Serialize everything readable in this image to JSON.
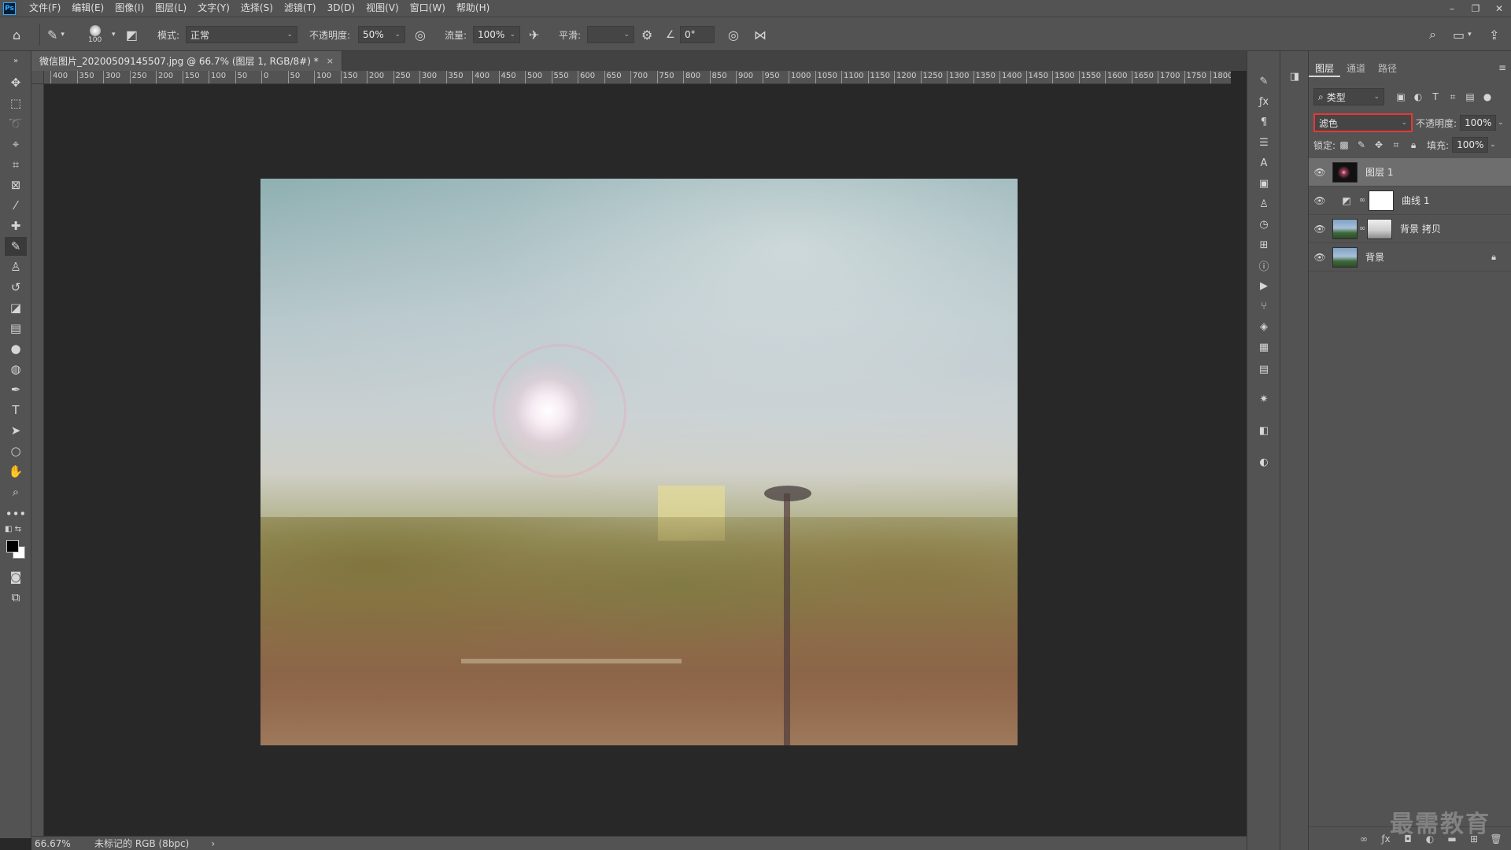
{
  "app": {
    "logo": "Ps"
  },
  "menu": [
    "文件(F)",
    "编辑(E)",
    "图像(I)",
    "图层(L)",
    "文字(Y)",
    "选择(S)",
    "滤镜(T)",
    "3D(D)",
    "视图(V)",
    "窗口(W)",
    "帮助(H)"
  ],
  "window_controls": {
    "minimize": "–",
    "restore": "❐",
    "close": "✕"
  },
  "options": {
    "brush_size": "100",
    "mode_label": "模式:",
    "mode_value": "正常",
    "opacity_label": "不透明度:",
    "opacity_value": "50%",
    "flow_label": "流量:",
    "flow_value": "100%",
    "smoothing_label": "平滑:",
    "smoothing_value": "",
    "angle_value": "0°"
  },
  "document": {
    "tab_title": "微信图片_20200509145507.jpg @ 66.7% (图层 1, RGB/8#) *",
    "tab_close": "×"
  },
  "ruler_h_labels": [
    "400",
    "350",
    "300",
    "250",
    "200",
    "150",
    "100",
    "50",
    "0",
    "50",
    "100",
    "150",
    "200",
    "250",
    "300",
    "350",
    "400",
    "450",
    "500",
    "550",
    "600",
    "650",
    "700",
    "750",
    "800",
    "850",
    "900",
    "950",
    "1000",
    "1050",
    "1100",
    "1150",
    "1200",
    "1250",
    "1300",
    "1350",
    "1400",
    "1450",
    "1500",
    "1550",
    "1600",
    "1650",
    "1700",
    "1750",
    "1800"
  ],
  "layers_panel": {
    "tabs": [
      "图层",
      "通道",
      "路径"
    ],
    "active_tab": "图层",
    "filter_kind": "类型",
    "blend_mode": "滤色",
    "opacity_label": "不透明度:",
    "opacity_value": "100%",
    "lock_label": "锁定:",
    "fill_label": "填充:",
    "fill_value": "100%",
    "layers": [
      {
        "name": "图层 1",
        "selected": true,
        "locked": false
      },
      {
        "name": "曲线 1",
        "selected": false,
        "locked": false
      },
      {
        "name": "背景 拷贝",
        "selected": false,
        "locked": false
      },
      {
        "name": "背景",
        "selected": false,
        "locked": true
      }
    ]
  },
  "status": {
    "zoom": "66.67%",
    "info": "未标记的 RGB (8bpc)",
    "arrow": "›"
  },
  "watermark": "最需教育",
  "colors": {
    "chrome": "#535353",
    "canvas_bg": "#282828",
    "highlight_border": "#e53935",
    "selected_layer": "#6e6e6e"
  }
}
